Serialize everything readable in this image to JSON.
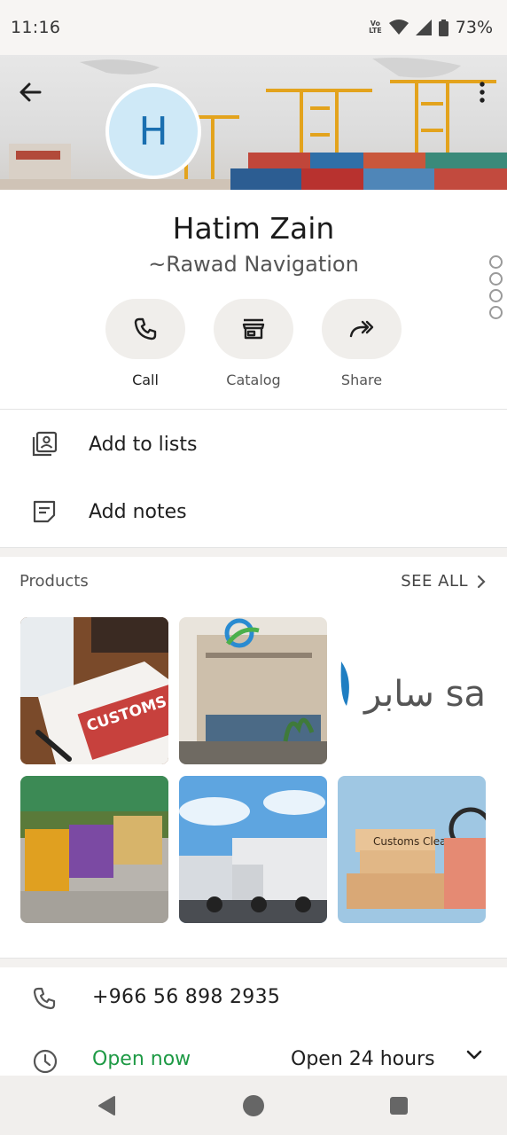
{
  "status_bar": {
    "time": "11:16",
    "network": "Vo LTE",
    "battery": "73%",
    "icons": [
      "volte-icon",
      "wifi-icon",
      "signal-icon",
      "battery-icon"
    ]
  },
  "header": {
    "avatar_letter": "H",
    "back_icon": "arrow-back-icon",
    "menu_icon": "more-vert-icon"
  },
  "profile": {
    "name": "Hatim Zain",
    "subtitle": "~Rawad Navigation"
  },
  "actions": [
    {
      "label": "Call",
      "icon": "phone-icon"
    },
    {
      "label": "Catalog",
      "icon": "storefront-icon"
    },
    {
      "label": "Share",
      "icon": "share-forward-icon"
    }
  ],
  "menu": {
    "add_to_lists": "Add to lists",
    "add_notes": "Add notes"
  },
  "products": {
    "title": "Products",
    "see_all": "SEE ALL",
    "items": [
      {
        "caption": "CUSTOMS CLEARA"
      },
      {
        "caption": ""
      },
      {
        "caption": "سابر sabe"
      },
      {
        "caption": ""
      },
      {
        "caption": ""
      },
      {
        "caption": "Customs Clearance"
      }
    ]
  },
  "contact": {
    "phone": "+966 56 898 2935",
    "open_status": "Open now",
    "hours": "Open 24 hours"
  },
  "colors": {
    "accent_green": "#1e9a45",
    "avatar_bg": "#cfe9f7",
    "avatar_text": "#1a6fb0"
  }
}
